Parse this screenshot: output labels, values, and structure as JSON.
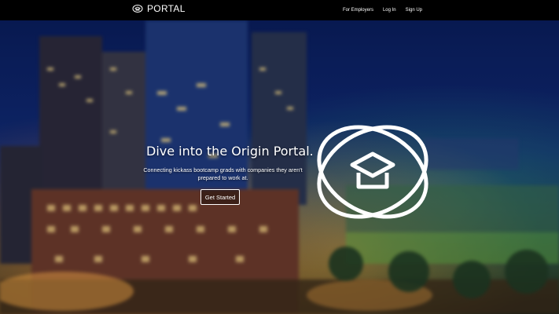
{
  "brand": {
    "name": "PORTAL",
    "logo_icon": "origin-logo-icon"
  },
  "nav": {
    "links": [
      {
        "label": "For Employers"
      },
      {
        "label": "Log In"
      },
      {
        "label": "Sign Up"
      }
    ]
  },
  "hero": {
    "headline": "Dive into the Origin Portal.",
    "subtext": "Connecting kickass bootcamp grads with companies they aren't prepared to work at.",
    "cta_label": "Get Started",
    "logo_icon": "origin-graduation-cap-logo-icon"
  },
  "colors": {
    "navbar": "#000000",
    "text": "#ffffff",
    "sky": "#0a1d5a"
  }
}
